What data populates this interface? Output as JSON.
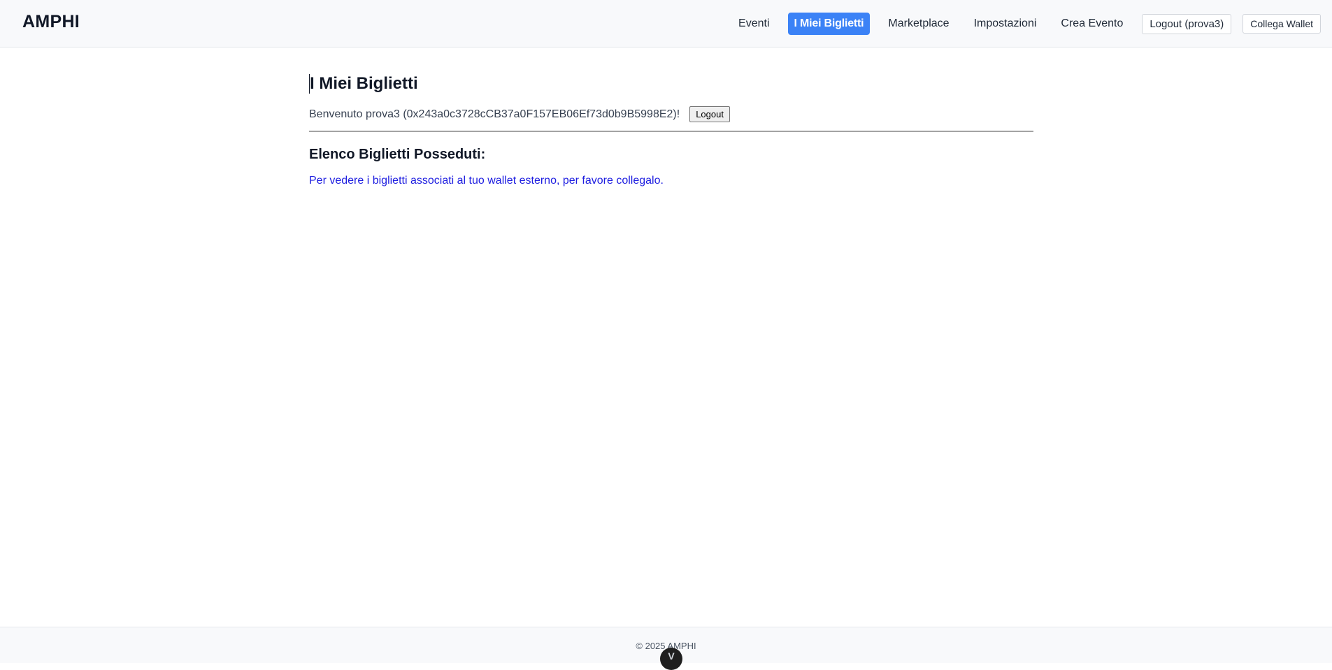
{
  "navbar": {
    "brand": "AMPHI",
    "links": [
      {
        "label": "Eventi",
        "active": false
      },
      {
        "label": "I Miei Biglietti",
        "active": true
      },
      {
        "label": "Marketplace",
        "active": false
      },
      {
        "label": "Impostazioni",
        "active": false
      },
      {
        "label": "Crea Evento",
        "active": false
      }
    ],
    "logout_label": "Logout (prova3)",
    "wallet_label": "Collega Wallet",
    "active_color": "#3b82f6"
  },
  "main": {
    "title": "I Miei Biglietti",
    "welcome_text": "Benvenuto prova3 (0x243a0c3728cCB37a0F157EB06Ef73d0b9B5998E2)!",
    "logout_button": "Logout",
    "section_title": "Elenco Biglietti Posseduti:",
    "info_text": "Per vedere i biglietti associati al tuo wallet esterno, per favore collegalo.",
    "info_color": "#1d1de0"
  },
  "footer": {
    "text": "© 2025 AMPHI"
  },
  "devtools": {
    "icon": "vue-devtools-icon",
    "glyph": "V"
  }
}
